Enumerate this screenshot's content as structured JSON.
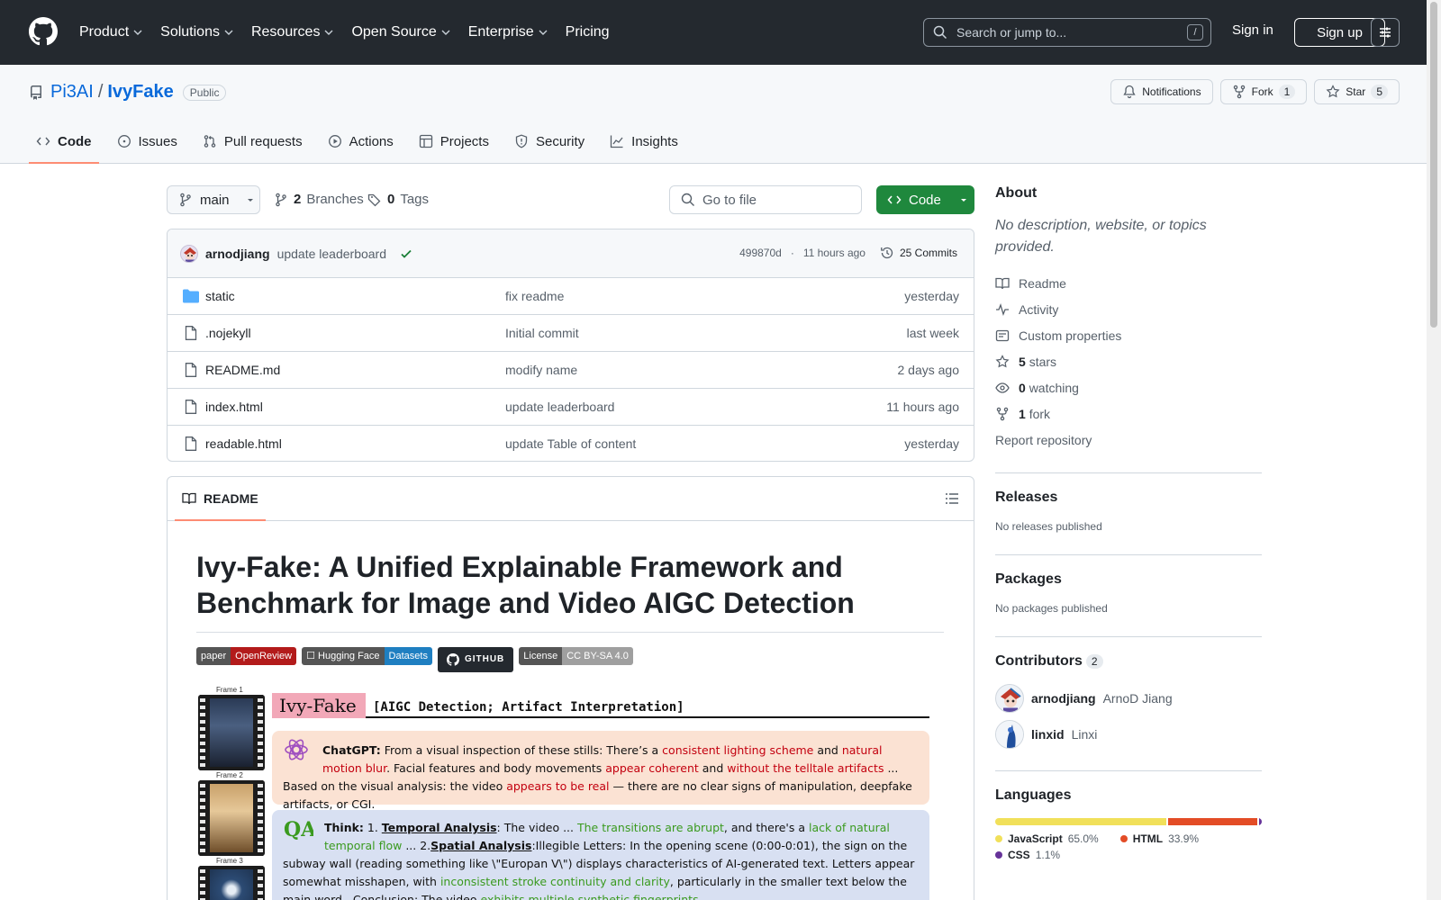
{
  "header": {
    "nav": [
      "Product",
      "Solutions",
      "Resources",
      "Open Source",
      "Enterprise",
      "Pricing"
    ],
    "search_placeholder": "Search or jump to...",
    "search_shortcut": "/",
    "sign_in": "Sign in",
    "sign_up": "Sign up"
  },
  "repo": {
    "owner": "Pi3AI",
    "separator": "/",
    "name": "IvyFake",
    "visibility": "Public",
    "notifications_label": "Notifications",
    "fork_label": "Fork",
    "fork_count": "1",
    "star_label": "Star",
    "star_count": "5",
    "tabs": [
      "Code",
      "Issues",
      "Pull requests",
      "Actions",
      "Projects",
      "Security",
      "Insights"
    ]
  },
  "toolbar": {
    "branch": "main",
    "branches_count": "2",
    "branches_label": "Branches",
    "tags_count": "0",
    "tags_label": "Tags",
    "goto_placeholder": "Go to file",
    "code_label": "Code"
  },
  "commit": {
    "author": "arnodjiang",
    "message": "update leaderboard",
    "sha": "499870d",
    "time_sep": "·",
    "time": "11 hours ago",
    "commits": "25 Commits"
  },
  "files": [
    {
      "type": "folder",
      "name": "static",
      "message": "fix readme",
      "time": "yesterday"
    },
    {
      "type": "file",
      "name": ".nojekyll",
      "message": "Initial commit",
      "time": "last week"
    },
    {
      "type": "file",
      "name": "README.md",
      "message": "modify name",
      "time": "2 days ago"
    },
    {
      "type": "file",
      "name": "index.html",
      "message": "update leaderboard",
      "time": "11 hours ago"
    },
    {
      "type": "file",
      "name": "readable.html",
      "message": "update Table of content",
      "time": "yesterday"
    }
  ],
  "readme": {
    "tab": "README",
    "title": "Ivy-Fake: A Unified Explainable Framework and Benchmark for Image and Video AIGC Detection",
    "shields": [
      {
        "left": "paper",
        "right": "OpenReview",
        "color": "#b31b1b"
      },
      {
        "left": "☐ Hugging Face",
        "right": "Datasets",
        "color": "#1f7fc1"
      },
      {
        "left": "License",
        "right": "CC BY-SA 4.0",
        "color": "#9f9f9f"
      }
    ],
    "github_badge": "GITHUB",
    "figure": {
      "frames": [
        "Frame 1",
        "Frame 2",
        "Frame 3"
      ],
      "banner_tag": "Ivy-Fake",
      "banner_sub": "[AIGC Detection; Artifact Interpretation]",
      "chat": {
        "speaker": "ChatGPT:",
        "t1": " From a visual inspection of these stills: There’s a ",
        "h1": "consistent lighting scheme",
        "t2": " and ",
        "h2": "natural motion blur",
        "t3": ". Facial features and body movements ",
        "h3": "appear coherent",
        "t4": " and ",
        "h4": "without the telltale artifacts",
        "t5": " ... Based on the visual analysis: the video ",
        "h5": "appears to be real",
        "t6": " — there are no clear signs of manipulation, deepfake artifacts, or CGI."
      },
      "think": {
        "label": "Think:",
        "n1": " 1. ",
        "s1": "Temporal Analysis",
        "t1": ": The video ... ",
        "g1": "The transitions are abrupt",
        "t2": ", and there's a ",
        "g2": "lack of natural temporal flow",
        "t3": " ... 2.",
        "s2": "Spatial Analysis",
        "t4": ":Illegible Letters: In the opening scene (0:00-0:01), the sign on the subway wall (reading something like \\\"Europan V\\\") displays characteristics of AI-generated text. Letters appear somewhat misshapen, with ",
        "g3": "inconsistent stroke continuity and clarity",
        "t5": ", particularly in the smaller text below the main word...Conclusion: The video ",
        "g4": "exhibits multiple synthetic fingerprints",
        "t6": "..."
      }
    }
  },
  "about": {
    "heading": "About",
    "description": "No description, website, or topics provided.",
    "links": {
      "readme": "Readme",
      "activity": "Activity",
      "custom": "Custom properties",
      "stars_n": "5",
      "stars": "stars",
      "watching_n": "0",
      "watching": "watching",
      "fork_n": "1",
      "fork": "fork"
    },
    "report": "Report repository"
  },
  "releases": {
    "heading": "Releases",
    "empty": "No releases published"
  },
  "packages": {
    "heading": "Packages",
    "empty": "No packages published"
  },
  "contributors": {
    "heading": "Contributors",
    "count": "2",
    "people": [
      {
        "login": "arnodjiang",
        "name": "ArnoD Jiang"
      },
      {
        "login": "linxid",
        "name": "Linxi"
      }
    ]
  },
  "languages": {
    "heading": "Languages",
    "items": [
      {
        "name": "JavaScript",
        "percent": "65.0%",
        "value": 65.0,
        "color": "#f1e05a"
      },
      {
        "name": "HTML",
        "percent": "33.9%",
        "value": 33.9,
        "color": "#e34c26"
      },
      {
        "name": "CSS",
        "percent": "1.1%",
        "value": 1.1,
        "color": "#663399"
      }
    ]
  }
}
